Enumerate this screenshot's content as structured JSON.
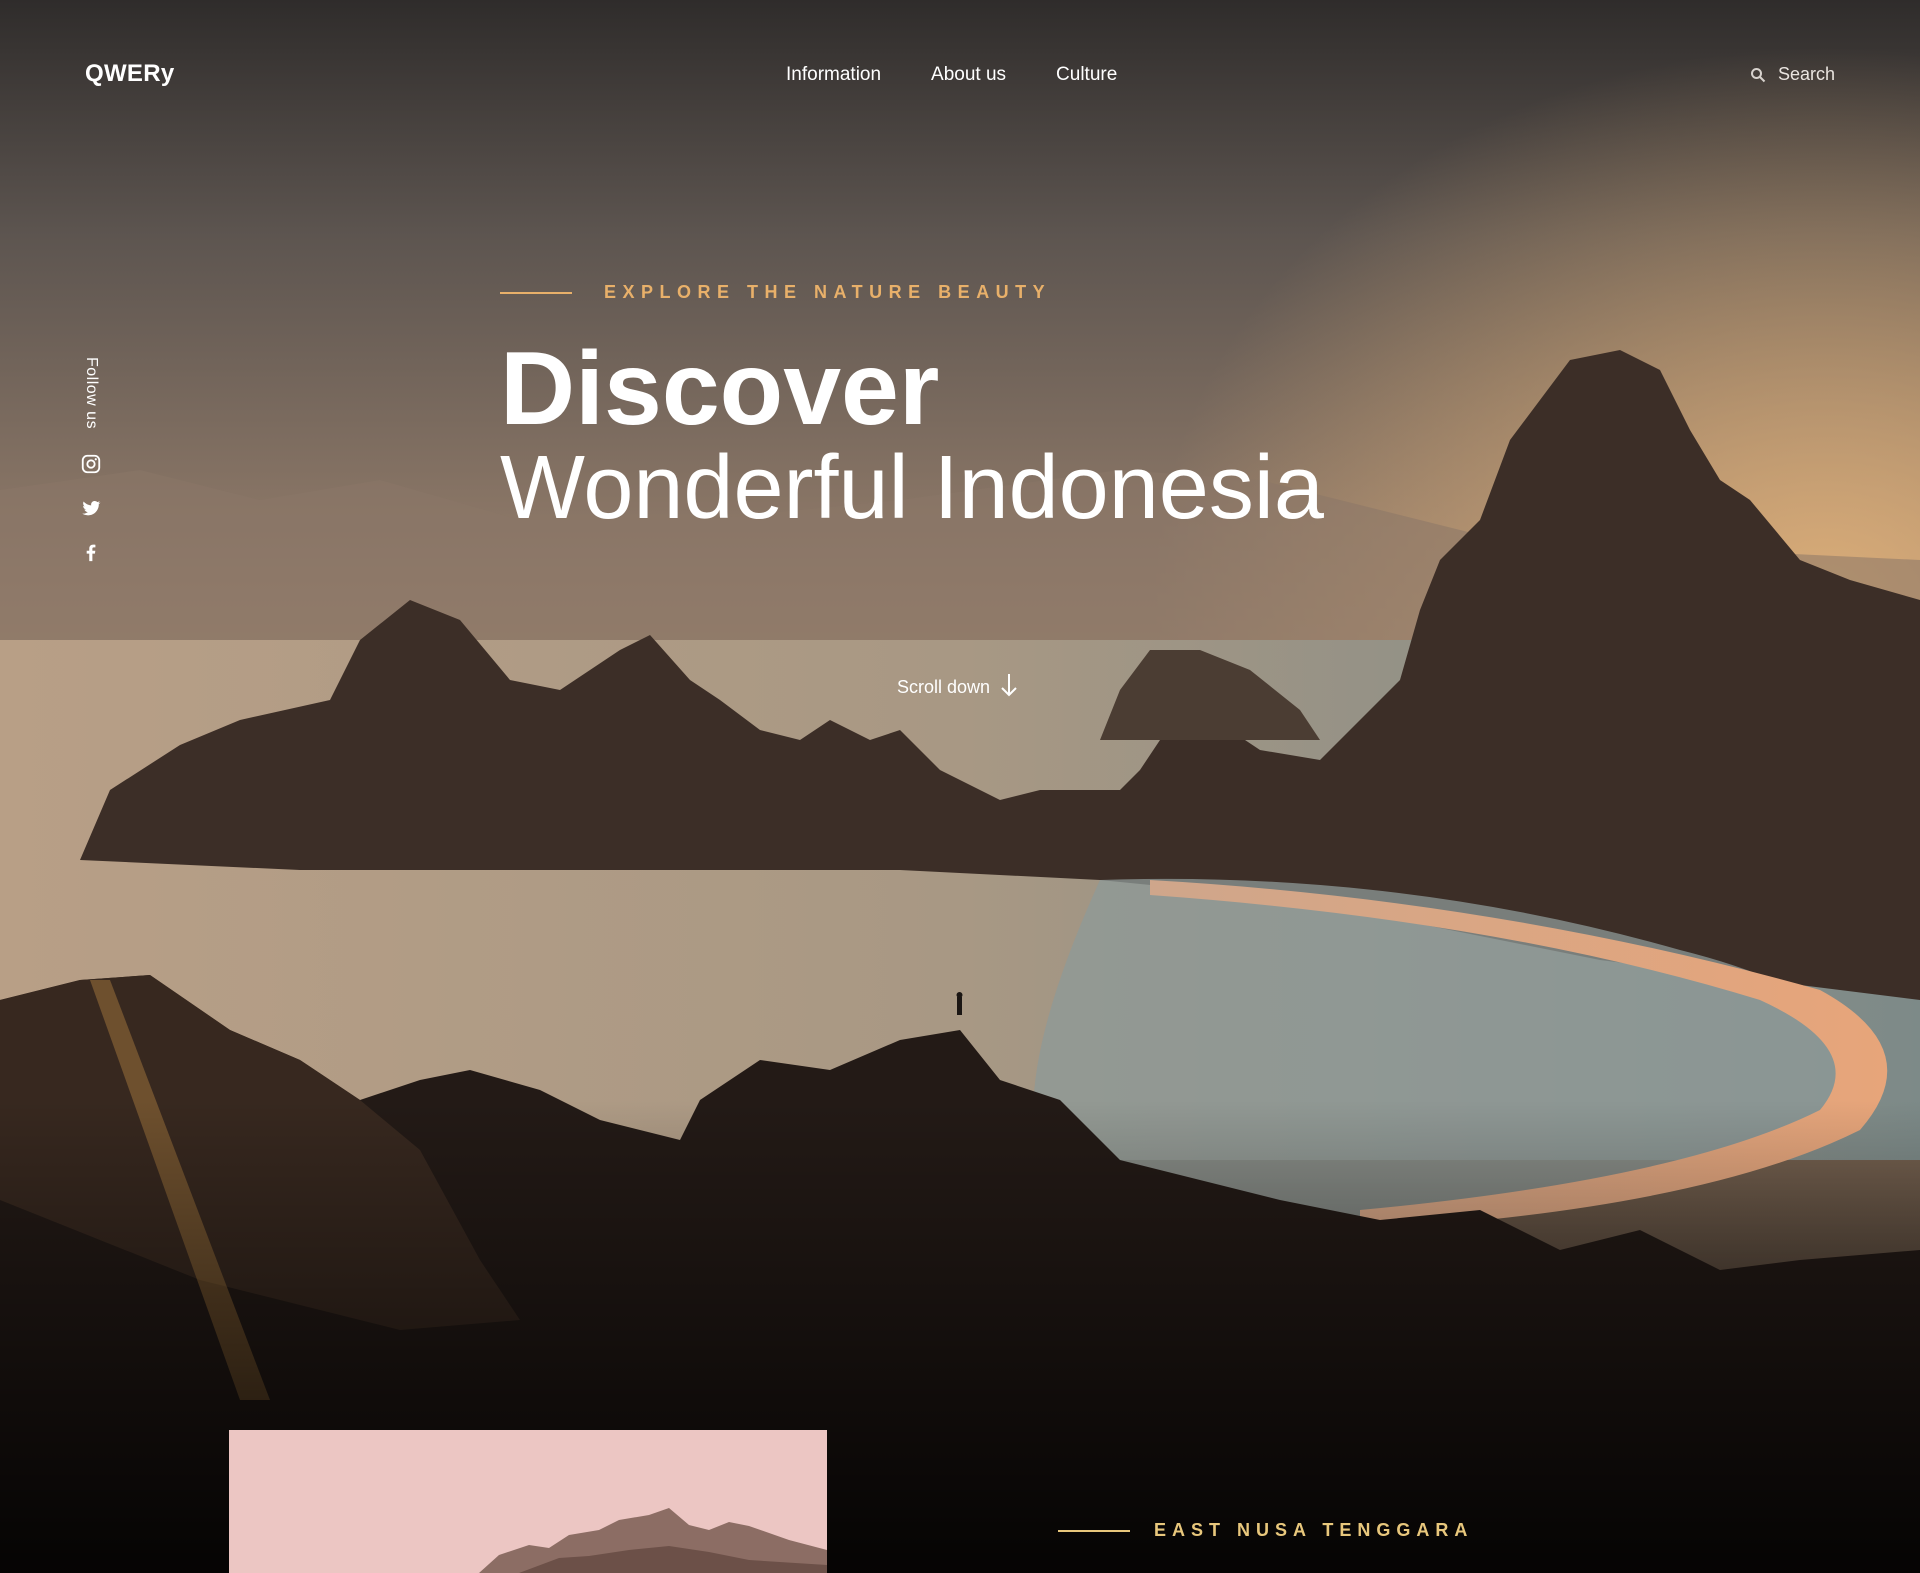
{
  "brand": {
    "logo": "QWERy"
  },
  "nav": {
    "items": [
      "Information",
      "About us",
      "Culture"
    ]
  },
  "search": {
    "placeholder": "Search",
    "icon": "search-icon"
  },
  "social": {
    "label": "Follow us",
    "icons": [
      "instagram-icon",
      "twitter-icon",
      "facebook-icon"
    ]
  },
  "hero": {
    "eyebrow": "EXPLORE THE NATURE BEAUTY",
    "title_line1": "Discover",
    "title_line2": "Wonderful Indonesia",
    "scroll": "Scroll down"
  },
  "section": {
    "eyebrow": "EAST NUSA TENGGARA"
  },
  "colors": {
    "accent": "#e8b06a",
    "section_accent": "#e8c77c",
    "text": "#ffffff"
  }
}
